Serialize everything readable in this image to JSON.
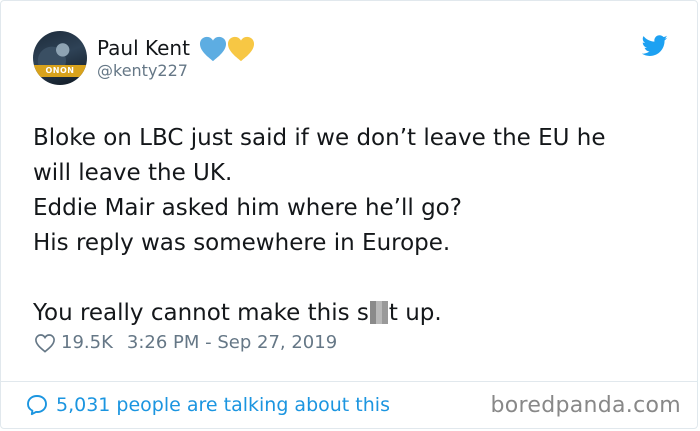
{
  "tweet": {
    "display_name": "Paul Kent",
    "handle": "@kenty227",
    "avatar_text": "ONON",
    "lines": [
      "Bloke on LBC just said if we don’t leave the EU he",
      "will leave the UK.",
      "Eddie Mair asked him where he’ll go?",
      "His reply was somewhere in Europe."
    ],
    "last_line_before": "You really cannot make this s",
    "last_line_after": "t up.",
    "like_count": "19.5K",
    "timestamp": "3:26 PM - Sep 27, 2019"
  },
  "footer": {
    "talking_text": "5,031 people are talking about this",
    "watermark": "boredpanda.com"
  },
  "icons": {
    "hearts": [
      "blue-heart-icon",
      "yellow-heart-icon"
    ],
    "bird": "twitter-bird-icon",
    "like": "heart-outline-icon",
    "reply": "speech-bubble-icon"
  },
  "colors": {
    "twitter_blue": "#1da1f2",
    "link_blue": "#1b95e0",
    "blue_heart": "#5dade2",
    "yellow_heart": "#f7c744",
    "text": "#14171a",
    "muted": "#657786"
  }
}
